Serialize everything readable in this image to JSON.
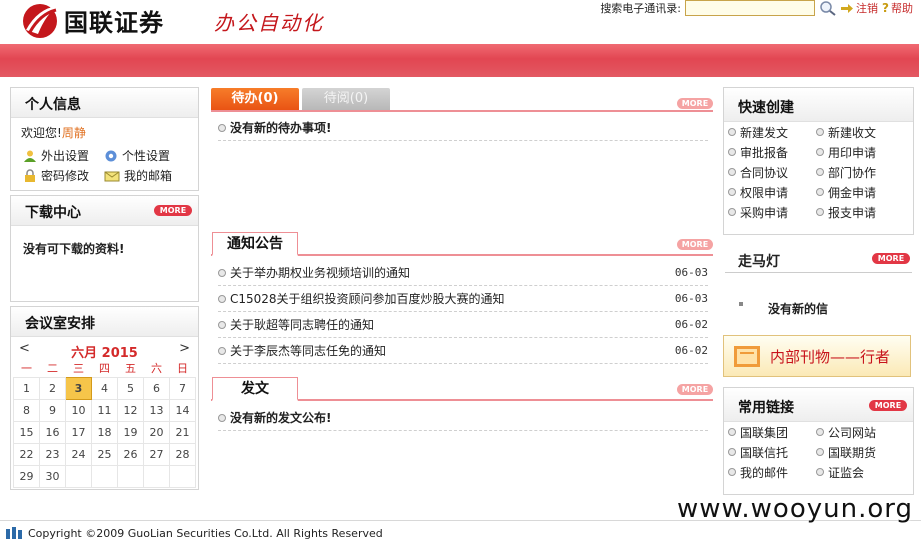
{
  "brand": {
    "logo_text": "国联证券",
    "system_name": "办公自动化"
  },
  "topbar": {
    "search_label": "搜索电子通讯录:",
    "search_value": "",
    "logout": "注销",
    "help": "帮助"
  },
  "personal": {
    "title": "个人信息",
    "welcome": "欢迎您!",
    "username": "周静",
    "links": [
      "外出设置",
      "个性设置",
      "密码修改",
      "我的邮箱"
    ]
  },
  "download": {
    "title": "下载中心",
    "more": "MORE",
    "empty": "没有可下载的资料!"
  },
  "meeting": {
    "title": "会议室安排",
    "prev": "<",
    "next": ">",
    "month_label": "六月 2015",
    "weekdays": [
      "一",
      "二",
      "三",
      "四",
      "五",
      "六",
      "日"
    ],
    "weeks": [
      [
        "1",
        "2",
        "3",
        "4",
        "5",
        "6",
        "7"
      ],
      [
        "8",
        "9",
        "10",
        "11",
        "12",
        "13",
        "14"
      ],
      [
        "15",
        "16",
        "17",
        "18",
        "19",
        "20",
        "21"
      ],
      [
        "22",
        "23",
        "24",
        "25",
        "26",
        "27",
        "28"
      ],
      [
        "29",
        "30",
        "",
        "",
        "",
        "",
        ""
      ]
    ],
    "today": "3"
  },
  "todo": {
    "tab_active": "待办(0)",
    "tab_inactive": "待阅(0)",
    "more": "MORE",
    "empty": "没有新的待办事项!"
  },
  "notice": {
    "title": "通知公告",
    "more": "MORE",
    "items": [
      {
        "text": "关于举办期权业务视频培训的通知",
        "date": "06-03"
      },
      {
        "text": "C15028关于组织投资顾问参加百度炒股大赛的通知",
        "date": "06-03"
      },
      {
        "text": "关于耿超等同志聘任的通知",
        "date": "06-02"
      },
      {
        "text": "关于李辰杰等同志任免的通知",
        "date": "06-02"
      }
    ]
  },
  "dispatch": {
    "title": "发文",
    "more": "MORE",
    "empty": "没有新的发文公布!"
  },
  "quick": {
    "title": "快速创建",
    "items": [
      "新建发文",
      "新建收文",
      "审批报备",
      "用印申请",
      "合同协议",
      "部门协作",
      "权限申请",
      "佣金申请",
      "采购申请",
      "报支申请"
    ]
  },
  "marquee": {
    "title": "走马灯",
    "more": "MORE",
    "text": "没有新的信"
  },
  "journal": {
    "label": "内部刊物——行者"
  },
  "links": {
    "title": "常用链接",
    "more": "MORE",
    "items": [
      "国联集团",
      "公司网站",
      "国联信托",
      "国联期货",
      "我的邮件",
      "证监会"
    ]
  },
  "footer": {
    "copyright": "Copyright ©2009 GuoLian Securities Co.Ltd. All Rights Reserved"
  },
  "watermark": {
    "text": "www.wooyun.org"
  },
  "colors": {
    "brand_red": "#c4171c",
    "banner": "#e24652",
    "tab_orange": "#e95314",
    "more_red": "#e23745"
  }
}
